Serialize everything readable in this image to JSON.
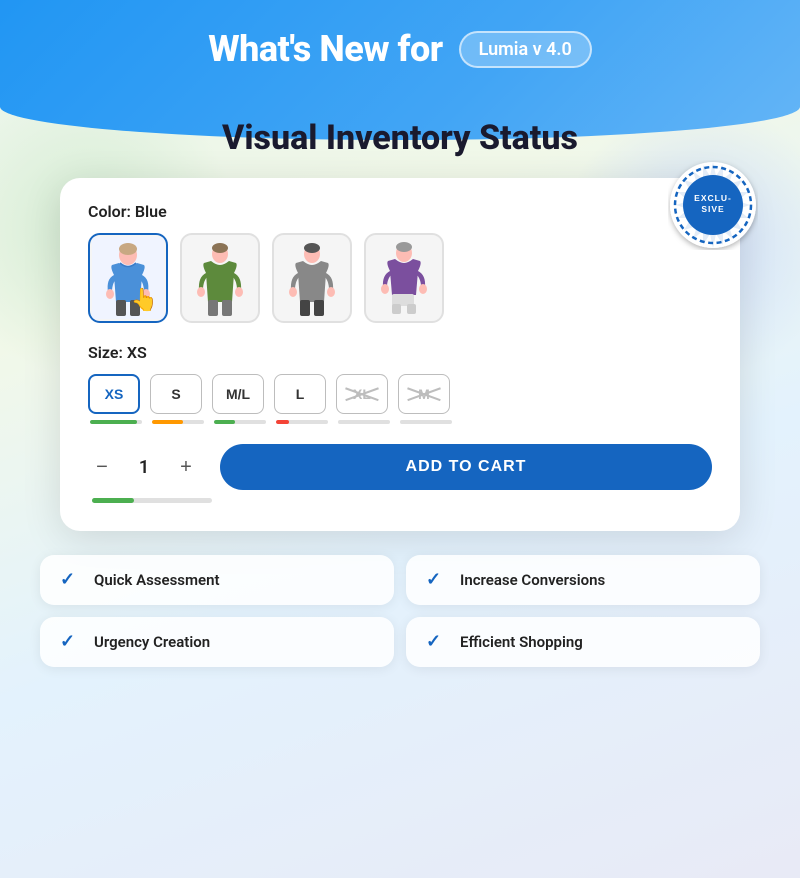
{
  "header": {
    "title": "What's New for",
    "badge": "Lumia v 4.0"
  },
  "section": {
    "title": "Visual Inventory Status"
  },
  "exclusive": {
    "label": "EXCLUSIVE"
  },
  "product": {
    "color_label": "Color: Blue",
    "size_label": "Size: XS",
    "sizes": [
      {
        "label": "XS",
        "active": true,
        "unavailable": false
      },
      {
        "label": "S",
        "active": false,
        "unavailable": false
      },
      {
        "label": "M/L",
        "active": false,
        "unavailable": false
      },
      {
        "label": "L",
        "active": false,
        "unavailable": false
      },
      {
        "label": "XL",
        "active": false,
        "unavailable": true
      },
      {
        "label": "M",
        "active": false,
        "unavailable": true
      }
    ],
    "quantity": "1",
    "add_to_cart": "ADD TO CART"
  },
  "features": [
    {
      "label": "Quick Assessment"
    },
    {
      "label": "Increase Conversions"
    },
    {
      "label": "Urgency Creation"
    },
    {
      "label": "Efficient Shopping"
    }
  ]
}
